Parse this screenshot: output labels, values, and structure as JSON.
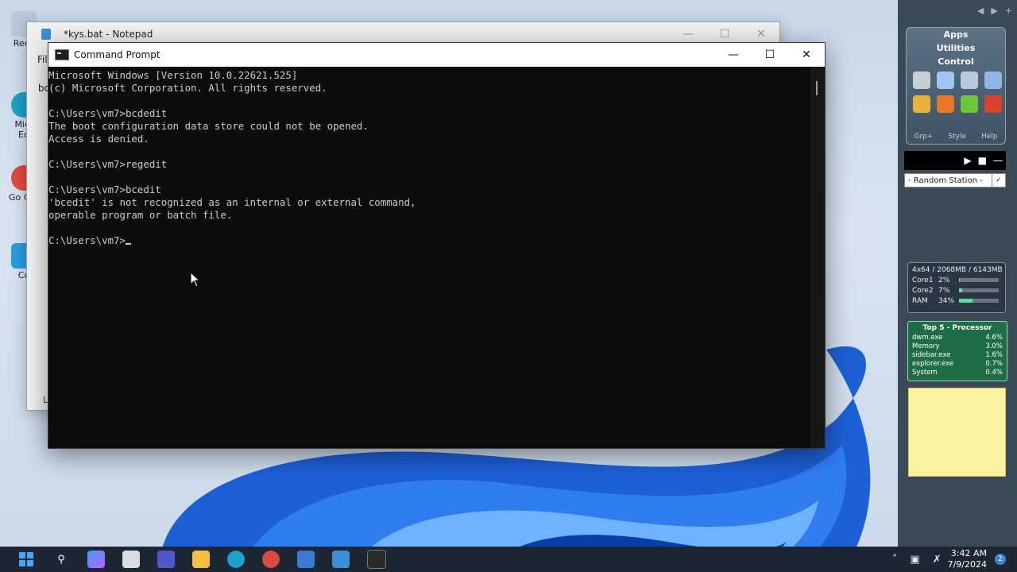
{
  "desktop": {
    "icons": [
      {
        "label": "Recy"
      },
      {
        "label": "Micr Ed"
      },
      {
        "label": "Go Chr"
      },
      {
        "label": "Co"
      }
    ]
  },
  "notepad": {
    "title": "*kys.bat - Notepad",
    "menu_first": "Fil",
    "body_text": "bc",
    "status": "L"
  },
  "cmd": {
    "title": "Command Prompt",
    "lines": [
      "Microsoft Windows [Version 10.0.22621.525]",
      "(c) Microsoft Corporation. All rights reserved.",
      "",
      "C:\\Users\\vm7>bcdedit",
      "The boot configuration data store could not be opened.",
      "Access is denied.",
      "",
      "C:\\Users\\vm7>regedit",
      "",
      "C:\\Users\\vm7>bcedit",
      "'bcedit' is not recognized as an internal or external command,",
      "operable program or batch file.",
      "",
      "C:\\Users\\vm7>"
    ]
  },
  "sidebar": {
    "launcher": {
      "tabs": [
        "Apps",
        "Utilities",
        "Control"
      ],
      "footer": [
        "Grp+",
        "Style",
        "Help"
      ]
    },
    "radio": {
      "station": "- Random Station -"
    },
    "meter": {
      "header": "4x64 / 2068MB / 6143MB",
      "rows": [
        {
          "label": "Core1",
          "pct": "2%",
          "level": 0.02
        },
        {
          "label": "Core2",
          "pct": "7%",
          "level": 0.07
        },
        {
          "label": "RAM",
          "pct": "34%",
          "level": 0.34
        }
      ]
    },
    "top5": {
      "title": "Top 5 - Processor",
      "rows": [
        {
          "name": "dwm.exe",
          "val": "4.6%"
        },
        {
          "name": "Memory",
          "val": "3.0%"
        },
        {
          "name": "sidebar.exe",
          "val": "1.6%"
        },
        {
          "name": "explorer.exe",
          "val": "0.7%"
        },
        {
          "name": "System",
          "val": "0.4%"
        }
      ]
    }
  },
  "taskbar": {
    "time": "3:42 AM",
    "date": "7/9/2024",
    "notifications": "2"
  },
  "colors": {
    "terminal_bg": "#0c0c0c",
    "terminal_fg": "#cccccc",
    "taskbar": "#1c2733",
    "sidebar": "#3b4a57",
    "top5_bg": "#1f6d47",
    "note": "#fbf3a0"
  }
}
